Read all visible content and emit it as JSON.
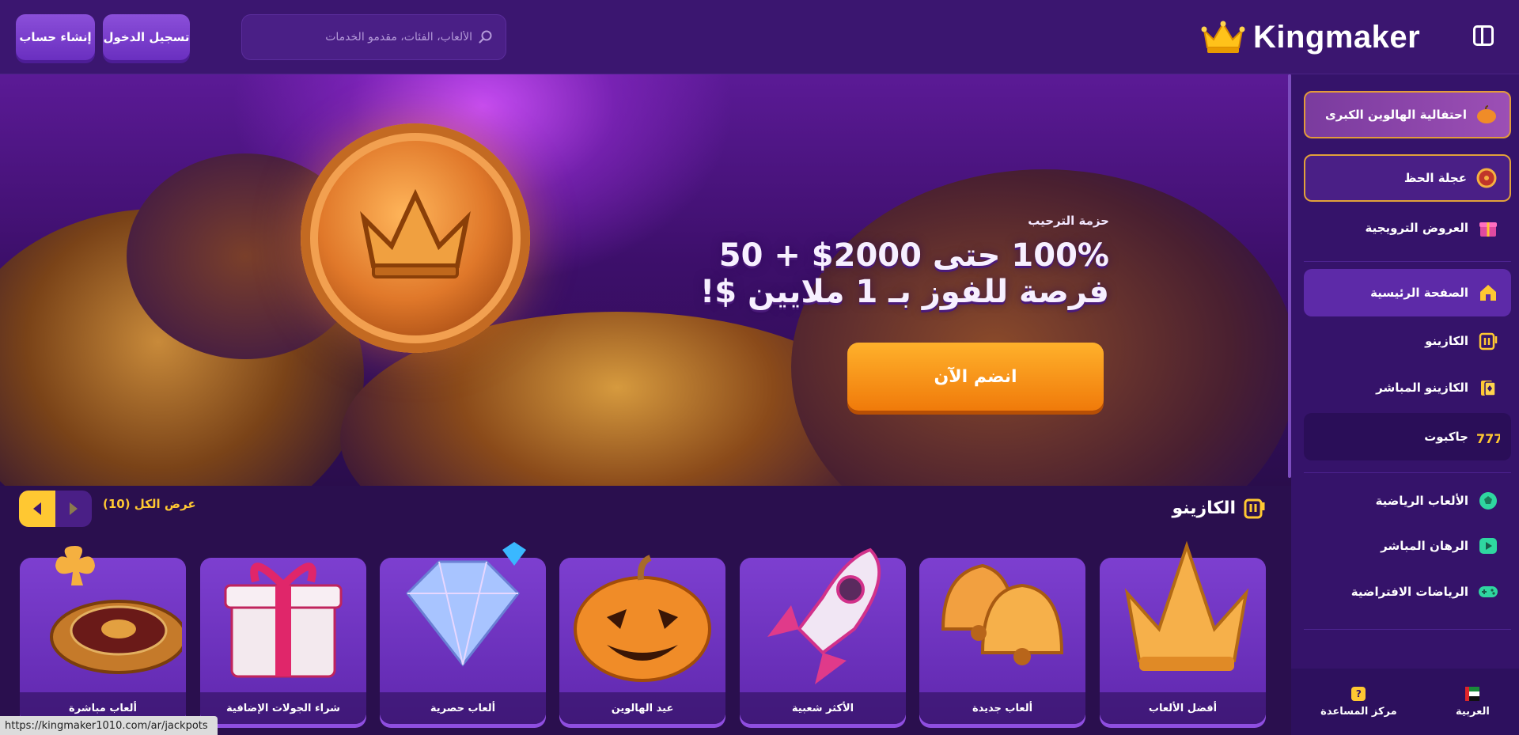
{
  "header": {
    "create_account": "إنشاء حساب",
    "login": "تسجيل الدخول",
    "search_placeholder": "الألعاب، الفئات، مقدمو الخدمات",
    "brand": "Kingmaker"
  },
  "sidebar": {
    "halloween": "احتفالية الهالوين الكبرى",
    "wheel": "عجلة الحظ",
    "promotions": "العروض الترويجية",
    "home": "الصفحة الرئيسية",
    "casino": "الكازينو",
    "live_casino": "الكازينو المباشر",
    "jackpot": "جاكبوت",
    "sports": "الألعاب الرياضية",
    "live_betting": "الرهان المباشر",
    "virtual_sports": "الرياضات الافتراضية",
    "language": "العربية",
    "help_center": "مركز المساعدة"
  },
  "hero": {
    "kicker": "حزمة الترحيب",
    "line1": "100% حتى 2000$ + 50",
    "line2": "فرصة للفوز بـ 1 ملايين $!",
    "cta": "انضم الآن"
  },
  "casino_section": {
    "title": "الكازينو",
    "see_all": "عرض الكل (10)",
    "cards": [
      "أفضل الألعاب",
      "ألعاب جديدة",
      "الأكثر شعبية",
      "عيد الهالوين",
      "ألعاب حصرية",
      "شراء الجولات الإضافية",
      "ألعاب مباشرة"
    ]
  },
  "status_bar": {
    "url": "https://kingmaker1010.com/ar/jackpots"
  },
  "colors": {
    "header_bg": "#3b1670",
    "sidebar_bg": "#35136a",
    "accent_orange": "#f59a1c",
    "accent_yellow": "#ffc832",
    "card_purple": "#6f33c2"
  }
}
